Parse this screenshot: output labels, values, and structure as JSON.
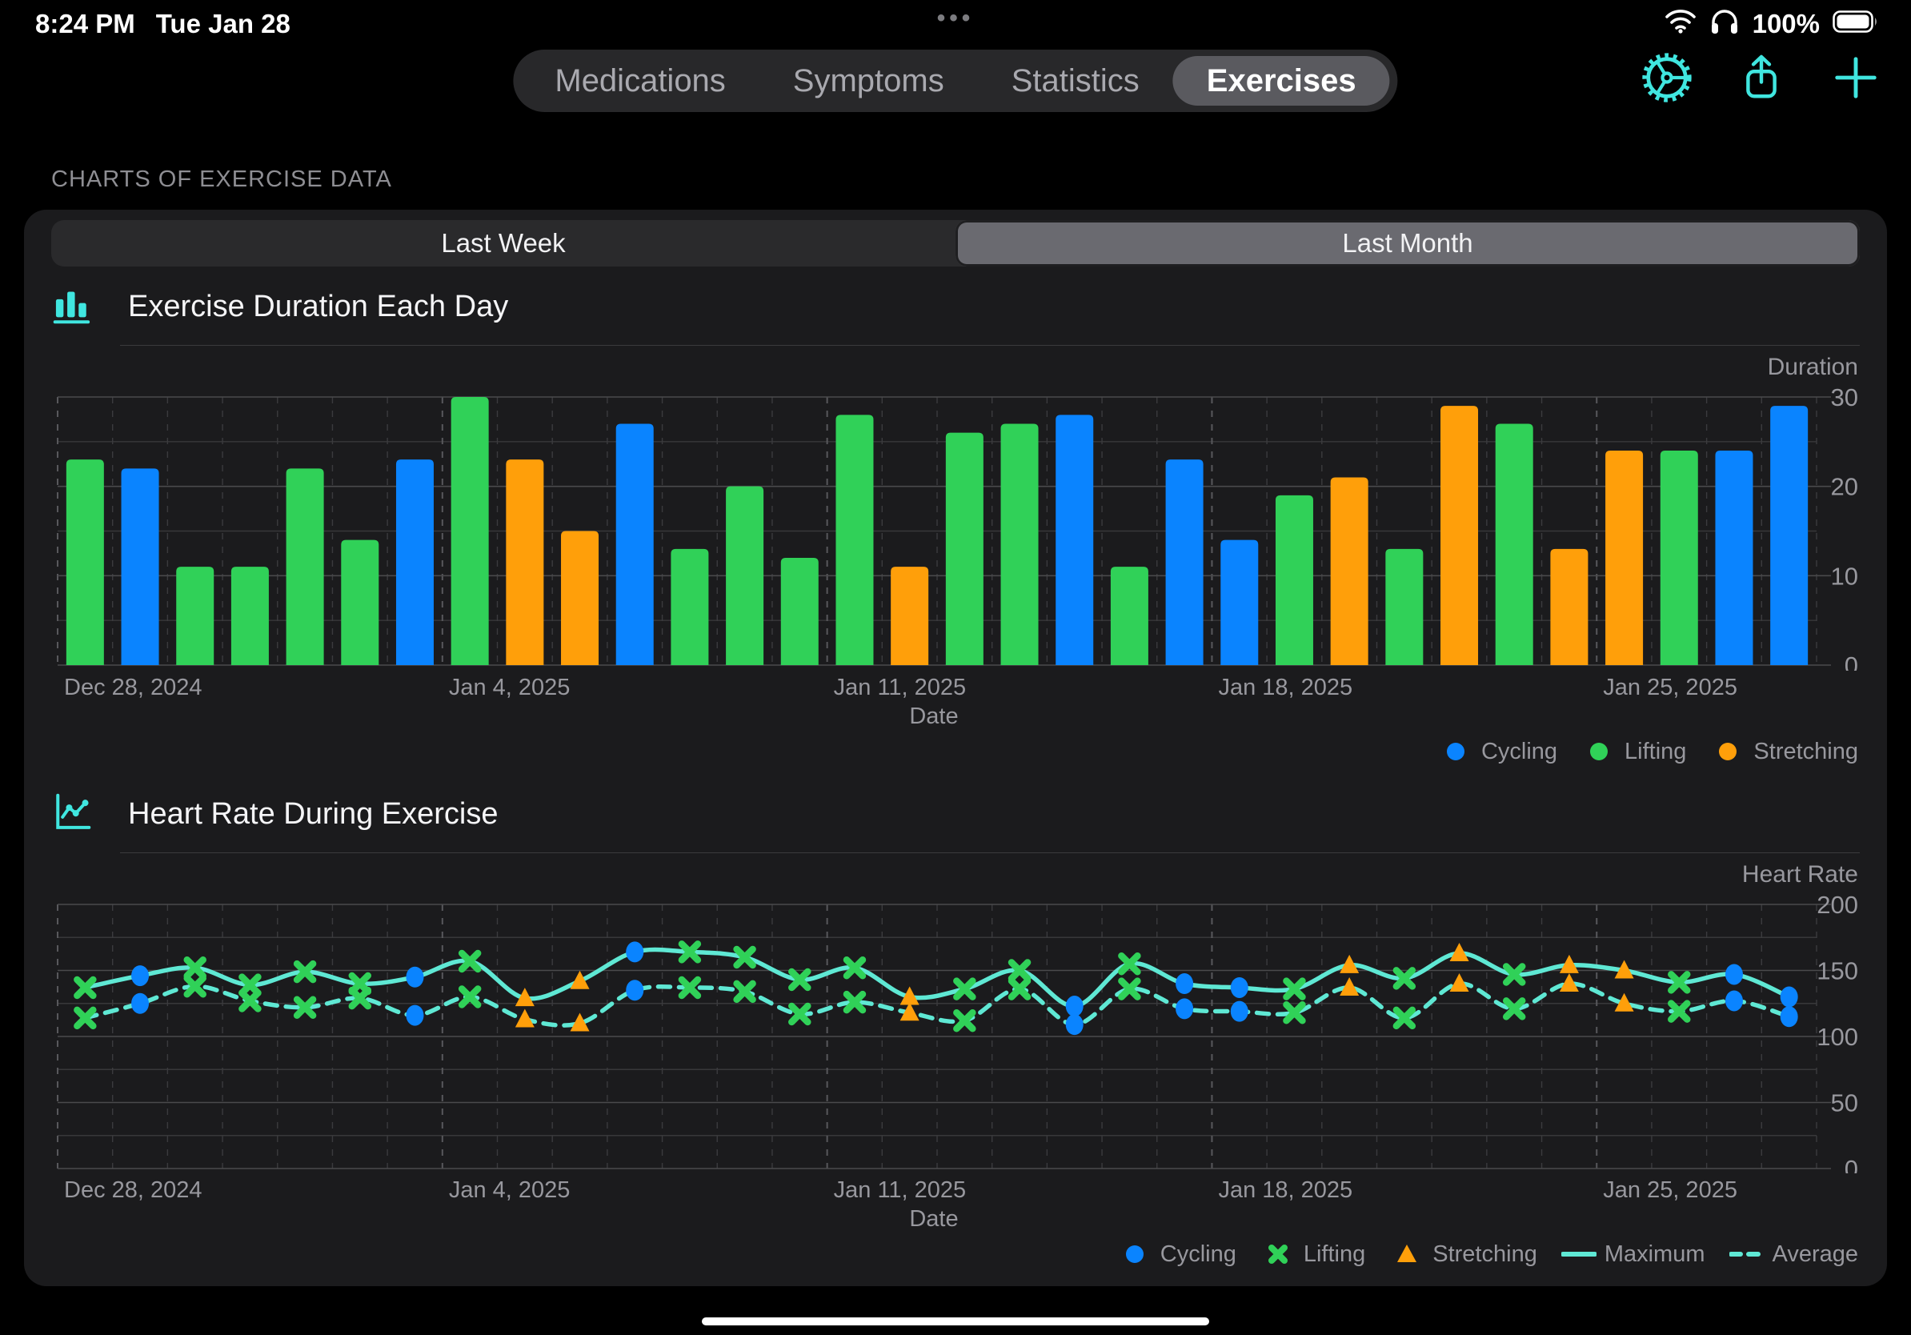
{
  "status_bar": {
    "time": "8:24 PM",
    "date": "Tue Jan 28",
    "battery_percent": "100%",
    "menu_dots": "•••"
  },
  "nav": {
    "tabs": [
      {
        "label": "Medications",
        "selected": false
      },
      {
        "label": "Symptoms",
        "selected": false
      },
      {
        "label": "Statistics",
        "selected": false
      },
      {
        "label": "Exercises",
        "selected": true
      }
    ],
    "action_icons": [
      "settings-gear-icon",
      "share-icon",
      "add-icon"
    ]
  },
  "section_title": "CHARTS OF EXERCISE DATA",
  "range_selector": {
    "options": [
      {
        "label": "Last Week",
        "selected": false
      },
      {
        "label": "Last Month",
        "selected": true
      }
    ]
  },
  "colors": {
    "accent_teal": "#40E6E0",
    "cycling_blue": "#0A84FF",
    "lifting_green": "#30D158",
    "stretching_orange": "#FF9F0A",
    "hr_line_mint": "#5FE8D4",
    "card_bg": "#1B1B1D",
    "grid_major": "#4A4A4C",
    "grid_minor": "#38383A",
    "label_gray": "#98989E"
  },
  "chart_data": [
    {
      "type": "bar",
      "title": "Exercise Duration Each Day",
      "icon": "bar-chart-icon",
      "ylabel": "Duration",
      "xlabel": "Date",
      "ylim": [
        0,
        30
      ],
      "yticks": [
        0,
        10,
        20,
        30
      ],
      "grid_step": 5,
      "x_tick_labels": [
        "Dec 28, 2024",
        "Jan 4, 2025",
        "Jan 11, 2025",
        "Jan 18, 2025",
        "Jan 25, 2025"
      ],
      "x_tick_days": [
        0,
        7,
        14,
        21,
        28
      ],
      "legend": [
        {
          "label": "Cycling",
          "marker": "circle",
          "color": "#0A84FF"
        },
        {
          "label": "Lifting",
          "marker": "circle",
          "color": "#30D158"
        },
        {
          "label": "Stretching",
          "marker": "circle",
          "color": "#FF9F0A"
        }
      ],
      "activity_colors": {
        "Cycling": "#0A84FF",
        "Lifting": "#30D158",
        "Stretching": "#FF9F0A"
      },
      "activities": [
        "Lifting",
        "Cycling",
        "Lifting",
        "Lifting",
        "Lifting",
        "Lifting",
        "Cycling",
        "Lifting",
        "Stretching",
        "Stretching",
        "Cycling",
        "Lifting",
        "Lifting",
        "Lifting",
        "Lifting",
        "Stretching",
        "Lifting",
        "Lifting",
        "Cycling",
        "Lifting",
        "Cycling",
        "Cycling",
        "Lifting",
        "Stretching",
        "Lifting",
        "Stretching",
        "Lifting",
        "Stretching",
        "Stretching",
        "Lifting",
        "Cycling",
        "Cycling"
      ],
      "values": [
        23,
        22,
        11,
        11,
        22,
        14,
        23,
        30,
        23,
        15,
        27,
        13,
        20,
        12,
        28,
        11,
        26,
        27,
        28,
        11,
        23,
        14,
        19,
        21,
        13,
        29,
        27,
        13,
        24,
        24,
        24,
        29
      ]
    },
    {
      "type": "line",
      "title": "Heart Rate During Exercise",
      "icon": "line-chart-icon",
      "ylabel": "Heart Rate",
      "xlabel": "Date",
      "ylim": [
        0,
        200
      ],
      "yticks": [
        0,
        50,
        100,
        150,
        200
      ],
      "grid_step": 25,
      "x_tick_labels": [
        "Dec 28, 2024",
        "Jan 4, 2025",
        "Jan 11, 2025",
        "Jan 18, 2025",
        "Jan 25, 2025"
      ],
      "x_tick_days": [
        0,
        7,
        14,
        21,
        28
      ],
      "legend": [
        {
          "label": "Cycling",
          "marker": "circle",
          "color": "#0A84FF"
        },
        {
          "label": "Lifting",
          "marker": "x",
          "color": "#30D158"
        },
        {
          "label": "Stretching",
          "marker": "triangle",
          "color": "#FF9F0A"
        },
        {
          "label": "Maximum",
          "marker": "solid-line",
          "color": "#5FE8D4"
        },
        {
          "label": "Average",
          "marker": "dashed-line",
          "color": "#5FE8D4"
        }
      ],
      "line_color": "#5FE8D4",
      "activity_colors": {
        "Cycling": "#0A84FF",
        "Lifting": "#30D158",
        "Stretching": "#FF9F0A"
      },
      "marker_activities": [
        "Lifting",
        "Cycling",
        "Lifting",
        "Lifting",
        "Lifting",
        "Lifting",
        "Cycling",
        "Lifting",
        "Stretching",
        "Stretching",
        "Cycling",
        "Lifting",
        "Lifting",
        "Lifting",
        "Lifting",
        "Stretching",
        "Lifting",
        "Lifting",
        "Cycling",
        "Lifting",
        "Cycling",
        "Cycling",
        "Lifting",
        "Stretching",
        "Lifting",
        "Stretching",
        "Lifting",
        "Stretching",
        "Stretching",
        "Lifting",
        "Cycling",
        "Cycling"
      ],
      "series": [
        {
          "name": "Maximum",
          "style": "solid",
          "values": [
            137,
            146,
            152,
            139,
            149,
            140,
            145,
            157,
            129,
            142,
            164,
            164,
            160,
            143,
            152,
            130,
            136,
            150,
            123,
            155,
            140,
            137,
            136,
            154,
            144,
            163,
            147,
            154,
            150,
            141,
            147,
            130
          ]
        },
        {
          "name": "Average",
          "style": "dashed",
          "values": [
            114,
            125,
            138,
            127,
            122,
            129,
            116,
            130,
            113,
            110,
            135,
            137,
            134,
            117,
            126,
            118,
            112,
            136,
            109,
            136,
            121,
            119,
            118,
            137,
            114,
            140,
            121,
            140,
            125,
            119,
            127,
            115
          ]
        }
      ]
    }
  ]
}
